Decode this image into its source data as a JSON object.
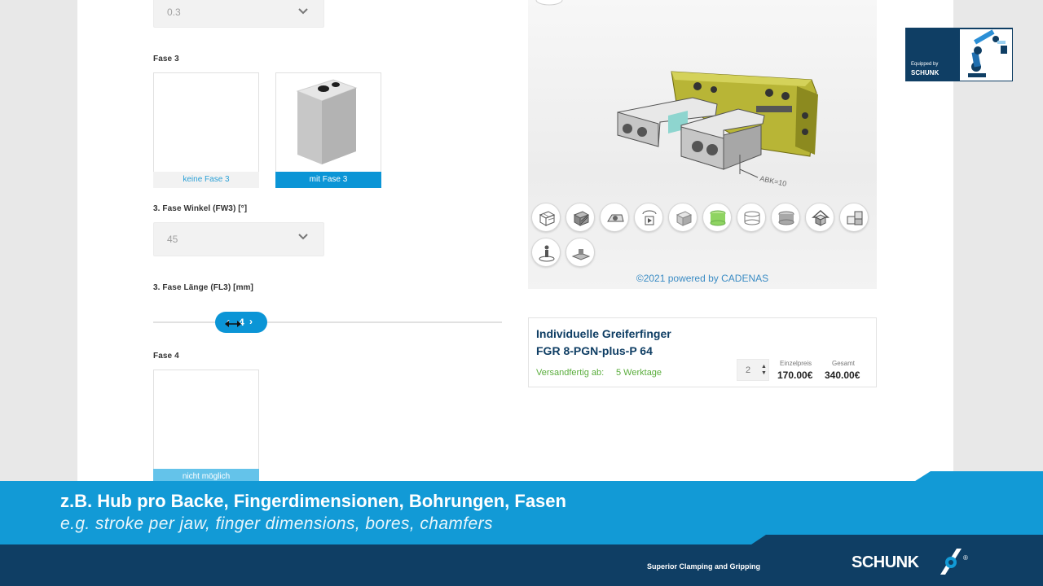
{
  "form": {
    "top_select_value": "0.3",
    "fase3": {
      "label": "Fase 3",
      "option_none": "keine Fase 3",
      "option_with": "mit Fase 3"
    },
    "fase3_angle": {
      "label": "3. Fase Winkel (FW3) [°]",
      "value": "45"
    },
    "fase3_length": {
      "label": "3. Fase Länge (FL3) [mm]",
      "slider_value": "4"
    },
    "fase4": {
      "label": "Fase 4",
      "option_disabled": "nicht möglich"
    }
  },
  "viewer": {
    "dimension_label": "ABK=10",
    "credit": "©2021 powered by CADENAS",
    "tools": [
      "wireframe-icon",
      "hatched-cube-icon",
      "textured-view-icon",
      "rotate-play-icon",
      "solid-cube-icon",
      "green-cylinder-icon",
      "outline-cylinder-icon",
      "gray-cylinder-icon",
      "house-view-icon",
      "explode-blocks-icon",
      "person-position-icon",
      "drawing-view-icon"
    ]
  },
  "product": {
    "title_line1": "Individuelle Greiferfinger",
    "title_line2": "FGR 8-PGN-plus-P 64",
    "shipping_label": "Versandfertig ab:",
    "shipping_value": "5 Werktage",
    "quantity": "2",
    "unit_price_label": "Einzelpreis",
    "total_label": "Gesamt",
    "unit_price": "170.00€",
    "total_price": "340.00€"
  },
  "badge": {
    "line1": "Equipped by",
    "line2": "SCHUNK"
  },
  "banner": {
    "line_de": "z.B. Hub pro Backe, Fingerdimensionen, Bohrungen, Fasen",
    "line_en": "e.g. stroke per jaw, finger dimensions, bores, chamfers"
  },
  "footer": {
    "slogan": "Superior Clamping and Gripping",
    "brand": "SCHUNK",
    "registered": "®"
  },
  "colors": {
    "primary_blue": "#0b95d6",
    "navy": "#0f3e64",
    "shipping_green": "#5aad3c"
  }
}
